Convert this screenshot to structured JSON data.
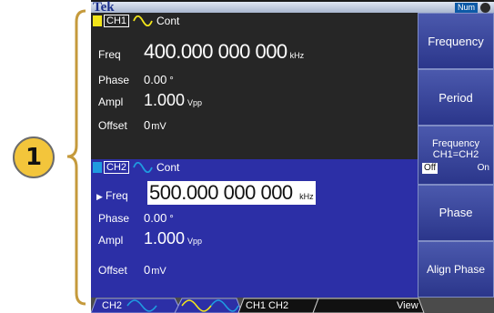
{
  "callout": {
    "number": "1"
  },
  "topbar": {
    "brand": "Tek",
    "num_badge": "Num"
  },
  "ch1": {
    "tag": "CH1",
    "mode": "Cont",
    "freq": {
      "label": "Freq",
      "value": "400.000 000 000",
      "unit": "kHz"
    },
    "phase": {
      "label": "Phase",
      "value": "0.00",
      "unit": "°"
    },
    "ampl": {
      "label": "Ampl",
      "value": "1.000",
      "unit": "Vpp"
    },
    "offset": {
      "label": "Offset",
      "value": "0",
      "unit": "mV"
    }
  },
  "ch2": {
    "tag": "CH2",
    "mode": "Cont",
    "freq": {
      "marker": "▶",
      "label": "Freq",
      "value": "500.000 000 000",
      "unit": "kHz"
    },
    "phase": {
      "label": "Phase",
      "value": "0.00",
      "unit": "°"
    },
    "ampl": {
      "label": "Ampl",
      "value": "1.000",
      "unit": "Vpp"
    },
    "offset": {
      "label": "Offset",
      "value": "0",
      "unit": "mV"
    }
  },
  "softkeys": {
    "frequency": "Frequency",
    "period": "Period",
    "freq_link_line1": "Frequency",
    "freq_link_line2": "CH1=CH2",
    "freq_link_off": "Off",
    "freq_link_on": "On",
    "phase": "Phase",
    "align_phase": "Align Phase"
  },
  "tabs": {
    "ch2": "CH2",
    "ch1_ch2": "CH1  CH2",
    "view": "View"
  },
  "colors": {
    "ch1": "#f2e51b",
    "ch2": "#1f9be0",
    "accent": "#2c2fa6",
    "callout": "#f3c53b",
    "bracket": "#c59a3c"
  }
}
